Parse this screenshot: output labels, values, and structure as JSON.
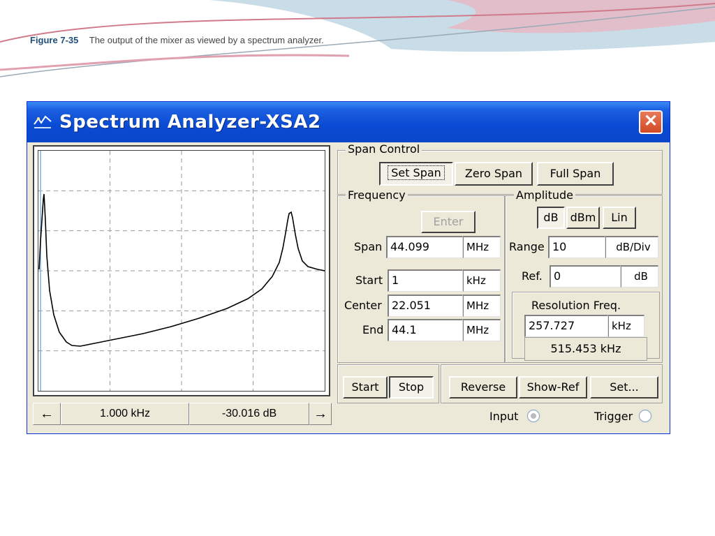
{
  "slide": {
    "figure_label": "Figure 7-35",
    "caption": "The output of the mixer as viewed by a spectrum analyzer."
  },
  "window": {
    "title": "Spectrum Analyzer-XSA2",
    "close_label": "✕"
  },
  "readout": {
    "left_arrow": "←",
    "frequency": "1.000 kHz",
    "level": "-30.016  dB",
    "right_arrow": "→"
  },
  "span_control": {
    "label": "Span Control",
    "set_span": "Set Span",
    "zero_span": "Zero Span",
    "full_span": "Full Span"
  },
  "frequency": {
    "label": "Frequency",
    "enter": "Enter",
    "span_label": "Span",
    "span_value": "44.099",
    "span_unit": "MHz",
    "start_label": "Start",
    "start_value": "1",
    "start_unit": "kHz",
    "center_label": "Center",
    "center_value": "22.051",
    "center_unit": "MHz",
    "end_label": "End",
    "end_value": "44.1",
    "end_unit": "MHz"
  },
  "amplitude": {
    "label": "Amplitude",
    "db": "dB",
    "dbm": "dBm",
    "lin": "Lin",
    "range_label": "Range",
    "range_value": "10",
    "range_unit": "dB/Div",
    "ref_label": "Ref.",
    "ref_value": "0",
    "ref_unit": "dB"
  },
  "resolution": {
    "label": "Resolution Freq.",
    "value": "257.727",
    "unit": "kHz",
    "computed": "515.453 kHz"
  },
  "bottom_buttons": {
    "start": "Start",
    "stop": "Stop",
    "reverse": "Reverse",
    "show_ref": "Show-Ref",
    "set": "Set..."
  },
  "radios": {
    "input": "Input",
    "trigger": "Trigger"
  },
  "colors": {
    "titlebar": "#0a4ad3",
    "cursor_line": "#7fb3e0",
    "marker": "#e05020"
  }
}
